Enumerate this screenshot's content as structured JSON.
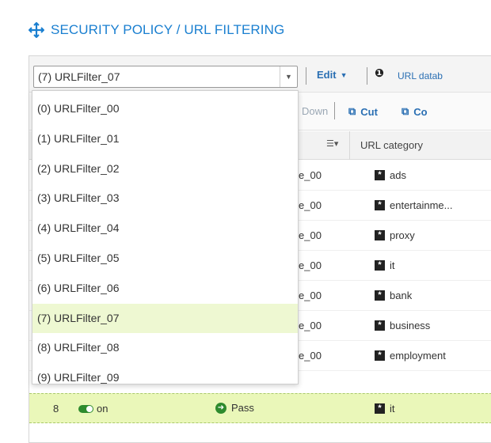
{
  "page": {
    "title": "SECURITY POLICY / URL FILTERING"
  },
  "toolbar": {
    "selected_filter": "(7) URLFilter_07",
    "edit_label": "Edit",
    "url_database_label": "URL datab"
  },
  "toolbar2": {
    "down_label": "Down",
    "cut_label": "Cut",
    "copy_label": "Co"
  },
  "table": {
    "header": {
      "url_category": "URL category"
    },
    "rows": [
      {
        "policy": "e_00",
        "category": "ads"
      },
      {
        "policy": "e_00",
        "category": "entertainme..."
      },
      {
        "policy": "e_00",
        "category": "proxy"
      },
      {
        "policy": "e_00",
        "category": "it"
      },
      {
        "policy": "e_00",
        "category": "bank"
      },
      {
        "policy": "e_00",
        "category": "business"
      },
      {
        "policy": "e_00",
        "category": "employment"
      }
    ],
    "selected_row": {
      "number": "8",
      "status": "on",
      "action": "Pass",
      "category": "it"
    }
  },
  "dropdown": {
    "options": [
      "(0) URLFilter_00",
      "(1) URLFilter_01",
      "(2) URLFilter_02",
      "(3) URLFilter_03",
      "(4) URLFilter_04",
      "(5) URLFilter_05",
      "(6) URLFilter_06",
      "(7) URLFilter_07",
      "(8) URLFilter_08",
      "(9) URLFilter_09"
    ],
    "highlighted_option": "(7) URLFilter_07"
  },
  "colors": {
    "accent": "#1a7fd0",
    "link": "#2a6fb3",
    "selected_row": "#eaf7b9",
    "toggle_on": "#2e8b2e"
  },
  "icons": [
    "move-arrows-icon",
    "chevron-down-icon",
    "info-icon",
    "cut-icon",
    "copy-icon",
    "sort-icon",
    "star-box-icon",
    "toggle-icon",
    "pass-arrow-icon"
  ]
}
